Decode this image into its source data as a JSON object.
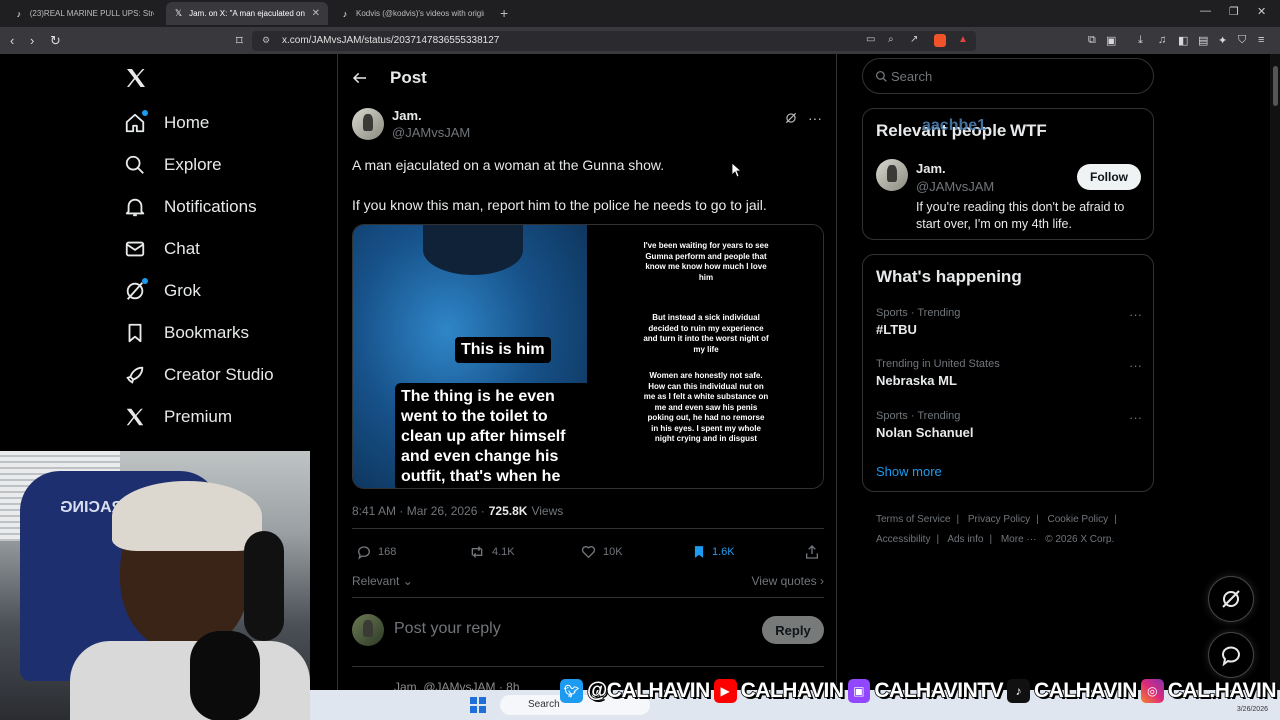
{
  "browser": {
    "tabs": [
      {
        "title": "(23)REAL MARINE PULL UPS: Strength",
        "icon": "tiktok-icon",
        "active": false
      },
      {
        "title": "Jam. on X: \"A man ejaculated on",
        "icon": "x-icon",
        "active": true
      },
      {
        "title": "Kodvis (@kodvis)'s videos with origin",
        "icon": "tiktok-icon",
        "active": false
      }
    ],
    "new_tab": "+",
    "url": "x.com/JAMvsJAM/status/2037147836555338127"
  },
  "sidebar": {
    "items": [
      {
        "label": "Home",
        "icon": "home-icon",
        "dot": true
      },
      {
        "label": "Explore",
        "icon": "search-icon",
        "dot": false
      },
      {
        "label": "Notifications",
        "icon": "bell-icon",
        "dot": false
      },
      {
        "label": "Chat",
        "icon": "mail-icon",
        "dot": false
      },
      {
        "label": "Grok",
        "icon": "grok-icon",
        "dot": true
      },
      {
        "label": "Bookmarks",
        "icon": "bookmark-icon",
        "dot": false
      },
      {
        "label": "Creator Studio",
        "icon": "rocket-icon",
        "dot": false
      },
      {
        "label": "Premium",
        "icon": "x-icon",
        "dot": false
      }
    ]
  },
  "post": {
    "header_title": "Post",
    "author_name": "Jam.",
    "author_handle": "@JAMvsJAM",
    "text_line1": "A man ejaculated on a woman at the Gunna show.",
    "text_line2": "If you know this man, report him to the police he needs to go to jail.",
    "media": {
      "tag": "This is him",
      "caption": "The thing is he even went to the toilet to clean up after himself and even change his outfit, that's when he",
      "right_paragraphs": [
        "I've been waiting for years to see Gumna perform and people that know me know how much I love him",
        "But instead a sick individual decided to ruin my experience and turn it into the worst night of my life",
        "Women are honestly not safe. How can this individual nut on me as I felt a white substance on me and even saw his penis poking out, he had no remorse in his eyes. I spent my whole night crying and in disgust"
      ]
    },
    "timestamp": "8:41 AM · Mar 26, 2026 ·",
    "views_count": "725.8K",
    "views_label": "Views",
    "stats": {
      "replies": "168",
      "reposts": "4.1K",
      "likes": "10K",
      "bookmarks": "1.6K"
    },
    "relevant_label": "Relevant",
    "view_quotes_label": "View quotes",
    "reply_placeholder": "Post your reply",
    "reply_button": "Reply",
    "next_reply_preview": "Jam. @JAMvsJAM · 8h"
  },
  "right": {
    "search_placeholder": "Search",
    "relevant_card": {
      "title_left": "Relevant people",
      "title_overlay": "aachbe1",
      "title_right": "WTF",
      "name": "Jam.",
      "handle": "@JAMvsJAM",
      "bio": "If you're reading this don't be afraid to start over, I'm on my 4th life.",
      "follow_label": "Follow"
    },
    "happening": {
      "title": "What's happening",
      "trends": [
        {
          "category": "Sports · Trending",
          "name": "#LTBU"
        },
        {
          "category": "Trending in United States",
          "name": "Nebraska ML"
        },
        {
          "category": "Sports · Trending",
          "name": "Nolan Schanuel"
        }
      ],
      "show_more": "Show more"
    },
    "footer": [
      "Terms of Service",
      "|",
      "Privacy Policy",
      "|",
      "Cookie Policy",
      "|",
      "Accessibility",
      "|",
      "Ads info",
      "|",
      "More ···",
      "© 2026 X Corp."
    ]
  },
  "overlay": {
    "webcam_chair_text": "DXRACING",
    "taskbar_search": "Search",
    "taskbar_date": "3/26/2026",
    "social": [
      {
        "icon": "twitter-icon",
        "handle": "@CALHAVIN"
      },
      {
        "icon": "youtube-icon",
        "handle": "CALHAVIN"
      },
      {
        "icon": "twitch-icon",
        "handle": "CALHAVINTV"
      },
      {
        "icon": "tiktok-icon",
        "handle": "CALHAVIN"
      },
      {
        "icon": "instagram-icon",
        "handle": "CAL.HAVIN"
      }
    ]
  },
  "colors": {
    "accent": "#1d9bf0",
    "muted": "#71767b",
    "border": "#2f3336",
    "text": "#e7e9ea"
  }
}
